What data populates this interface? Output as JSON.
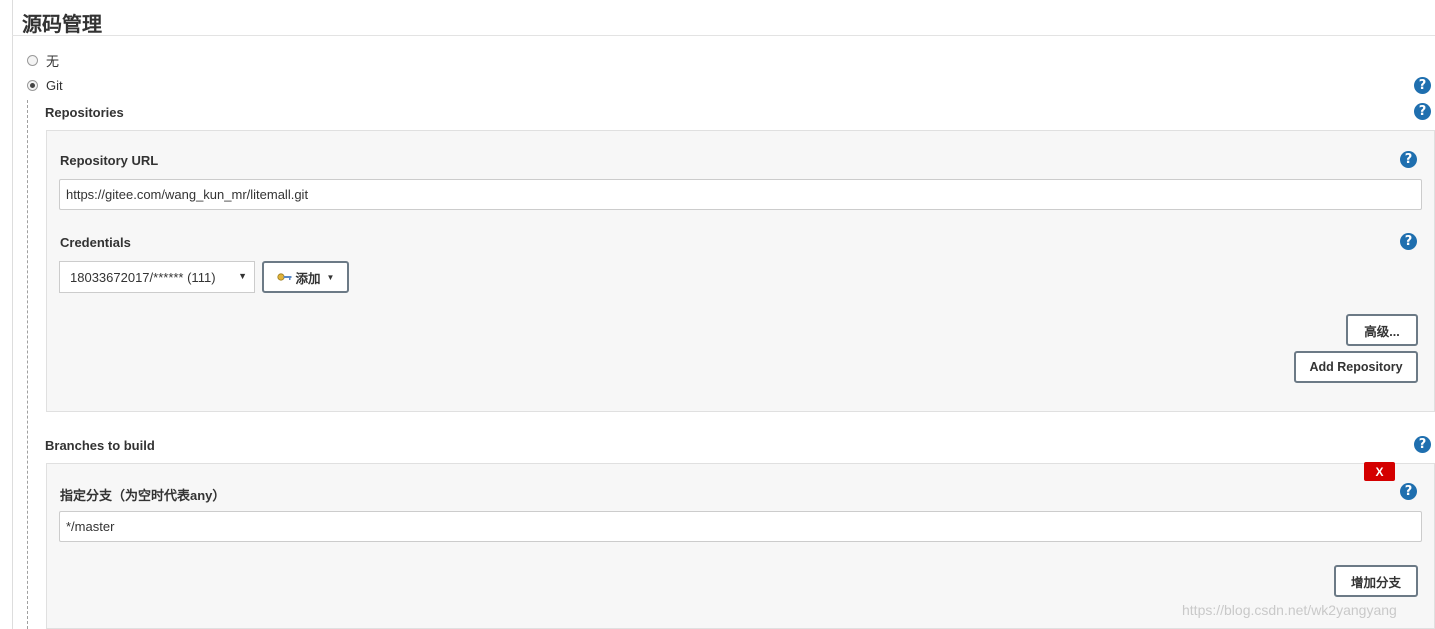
{
  "section": {
    "title": "源码管理"
  },
  "scm": {
    "none_label": "无",
    "git_label": "Git",
    "selected": "git"
  },
  "repositories": {
    "label": "Repositories",
    "url_label": "Repository URL",
    "url_value": "https://gitee.com/wang_kun_mr/litemall.git",
    "credentials_label": "Credentials",
    "credentials_value": "18033672017/****** (111)",
    "add_label": "添加",
    "advanced_label": "高级...",
    "add_repository_label": "Add Repository"
  },
  "branches": {
    "label": "Branches to build",
    "branch_spec_label": "指定分支（为空时代表any）",
    "branch_spec_value": "*/master",
    "delete_label": "X",
    "add_branch_label": "增加分支"
  },
  "help_glyph": "?",
  "watermark": "https://blog.csdn.net/wk2yangyang",
  "colors": {
    "help_icon": "#1f6faf",
    "delete_button": "#d40000",
    "panel_bg": "#f7f7f7"
  }
}
